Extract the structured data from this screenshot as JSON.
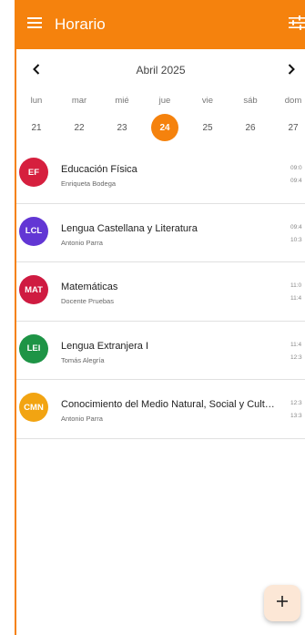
{
  "app_bar": {
    "title": "Horario",
    "background_color": "#f5820d",
    "menu_icon": "hamburger-menu-icon",
    "filter_icon": "sliders-icon"
  },
  "calendar": {
    "month_label": "Abril 2025",
    "prev_icon": "chevron-left-icon",
    "next_icon": "chevron-right-icon",
    "weekdays": [
      "lun",
      "mar",
      "mié",
      "jue",
      "vie",
      "sáb",
      "dom"
    ],
    "days": [
      "21",
      "22",
      "23",
      "24",
      "25",
      "26",
      "27"
    ],
    "selected_day": "24",
    "accent_color": "#f5820d"
  },
  "schedule": [
    {
      "abbr": "EF",
      "color": "#d61f3e",
      "subject": "Educación Física",
      "teacher": "Enriqueta Bodega",
      "start": "09:0",
      "end": "09:4"
    },
    {
      "abbr": "LCL",
      "color": "#6236d4",
      "subject": "Lengua Castellana y Literatura",
      "teacher": "Antonio Parra",
      "start": "09:4",
      "end": "10:3"
    },
    {
      "abbr": "MAT",
      "color": "#cf1b41",
      "subject": "Matemáticas",
      "teacher": "Docente Pruebas",
      "start": "11:0",
      "end": "11:4"
    },
    {
      "abbr": "LEI",
      "color": "#1e9446",
      "subject": "Lengua Extranjera I",
      "teacher": "Tomás Alegría",
      "start": "11:4",
      "end": "12:3"
    },
    {
      "abbr": "CMN",
      "color": "#f2a412",
      "subject": "Conocimiento del Medio Natural, Social y Cultural",
      "teacher": "Antonio Parra",
      "start": "12:3",
      "end": "13:3"
    }
  ],
  "fab": {
    "label": "+",
    "icon": "add-icon"
  }
}
